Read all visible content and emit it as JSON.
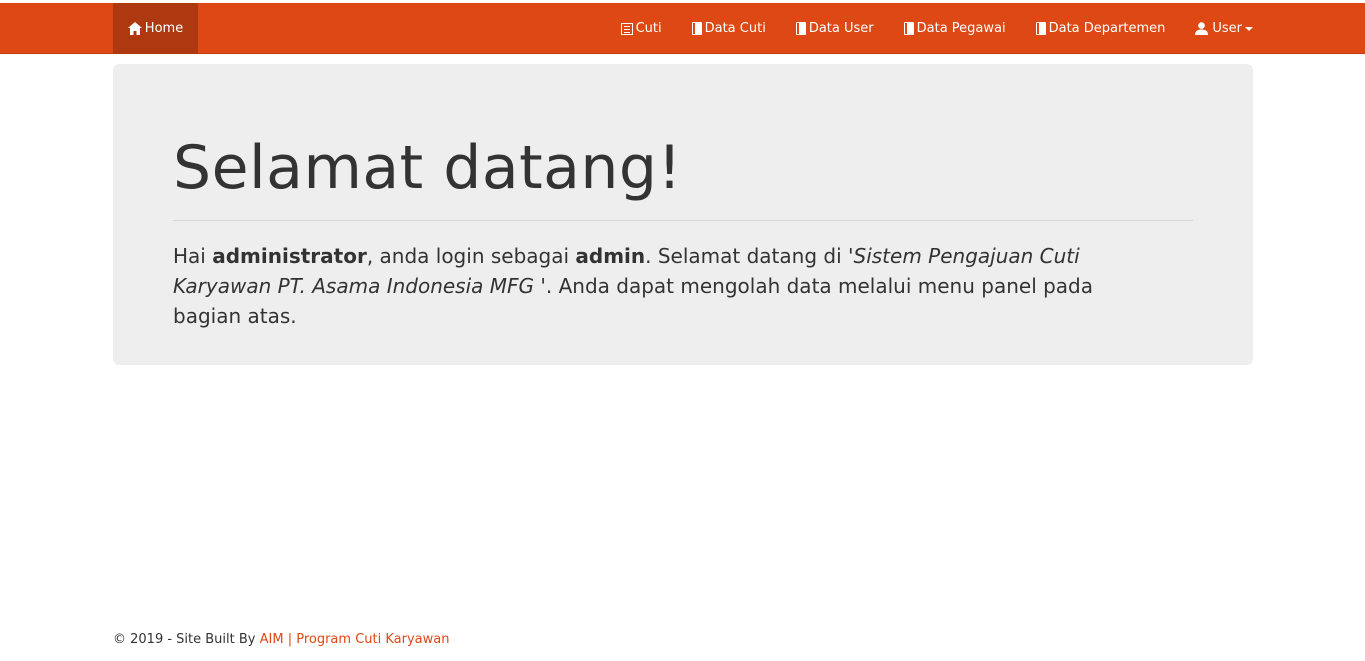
{
  "navbar": {
    "home_label": "Home",
    "items": [
      {
        "label": "Cuti",
        "icon": "list-icon"
      },
      {
        "label": "Data Cuti",
        "icon": "book-icon"
      },
      {
        "label": "Data User",
        "icon": "book-icon"
      },
      {
        "label": "Data Pegawai",
        "icon": "book-icon"
      },
      {
        "label": "Data Departemen",
        "icon": "book-icon"
      }
    ],
    "user_label": "User",
    "colors": {
      "background": "#dd4814",
      "active": "#ae3910"
    }
  },
  "jumbotron": {
    "title": "Selamat datang!",
    "greeting": "Hai ",
    "username": "administrator",
    "role_prefix": ", anda login sebagai ",
    "role": "admin",
    "welcome_prefix": ". Selamat datang di ",
    "system_name": "'Sistem Pengajuan Cuti Karyawan PT. Asama Indonesia MFG '",
    "instruction": ". Anda dapat mengolah data melalui menu panel pada bagian atas."
  },
  "footer": {
    "copyright": "© 2019 - Site Built By ",
    "link_text": "AIM | Program Cuti Karyawan",
    "link_color": "#dd4814"
  }
}
